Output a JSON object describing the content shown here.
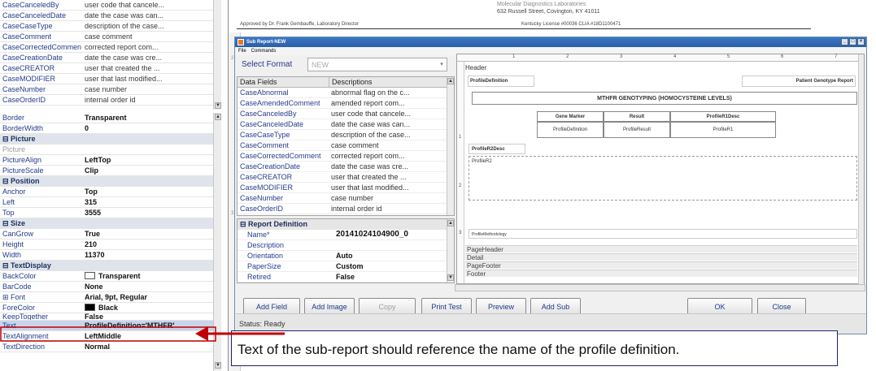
{
  "background_report": {
    "header": "Molecular Diagnostics Laboratories",
    "address": "632 Russell Street, Covington, KY 41011",
    "approved": "Approved by Dr. Frank Gembauffe, Laboratory Director",
    "license": "Kentucky License #00036 CLIA #18D1100471",
    "left_numbers": [
      "1",
      "2",
      "3"
    ]
  },
  "left_panel": {
    "fields_list": [
      [
        "CaseCanceledBy",
        "user code that cancele..."
      ],
      [
        "CaseCanceledDate",
        "date the case was can..."
      ],
      [
        "CaseCaseType",
        "description of the case..."
      ],
      [
        "CaseComment",
        "case comment"
      ],
      [
        "CaseCorrectedComment",
        "corrected report com..."
      ],
      [
        "CaseCreationDate",
        "date the case was cre..."
      ],
      [
        "CaseCREATOR",
        "user that created the ..."
      ],
      [
        "CaseMODIFIER",
        "user that last modified..."
      ],
      [
        "CaseNumber",
        "case number"
      ],
      [
        "CaseOrderID",
        "internal order id"
      ]
    ],
    "properties": {
      "border": [
        "Border",
        "Transparent"
      ],
      "border_width": [
        "BorderWidth",
        "0"
      ],
      "cat_picture": "Picture",
      "picture": [
        "Picture",
        ""
      ],
      "picture_align": [
        "PictureAlign",
        "LeftTop"
      ],
      "picture_scale": [
        "PictureScale",
        "Clip"
      ],
      "cat_position": "Position",
      "anchor": [
        "Anchor",
        "Top"
      ],
      "left": [
        "Left",
        "315"
      ],
      "top": [
        "Top",
        "3555"
      ],
      "cat_size": "Size",
      "can_grow": [
        "CanGrow",
        "True"
      ],
      "height": [
        "Height",
        "210"
      ],
      "width": [
        "Width",
        "11370"
      ],
      "cat_textdisplay": "TextDisplay",
      "back_color": [
        "BackColor",
        "Transparent"
      ],
      "bar_code": [
        "BarCode",
        "None"
      ],
      "font": [
        "Font",
        "Arial, 9pt, Regular"
      ],
      "fore_color": [
        "ForeColor",
        "Black"
      ],
      "keep_together": [
        "KeepTogether",
        "False"
      ],
      "text": [
        "Text",
        "ProfileDefinition='MTHFR'"
      ],
      "text_alignment": [
        "TextAlignment",
        "LeftMiddle"
      ],
      "text_direction": [
        "TextDirection",
        "Normal"
      ]
    },
    "colors": {
      "back": "#ffffff",
      "fore": "#000000"
    }
  },
  "window": {
    "title": "Sub Report-NEW",
    "menu": [
      "File",
      "Commands"
    ],
    "controls": [
      "_",
      "□",
      "×"
    ],
    "select_format_label": "Select Format",
    "select_format_value": "NEW",
    "fields_headers": [
      "Data Fields",
      "Descriptions"
    ],
    "fields": [
      [
        "CaseAbnormal",
        "abnormal flag on the c..."
      ],
      [
        "CaseAmendedComment",
        "amended report com..."
      ],
      [
        "CaseCanceledBy",
        "user code that cancele..."
      ],
      [
        "CaseCanceledDate",
        "date the case was can..."
      ],
      [
        "CaseCaseType",
        "description of the case..."
      ],
      [
        "CaseComment",
        "case comment"
      ],
      [
        "CaseCorrectedComment",
        "corrected report com..."
      ],
      [
        "CaseCreationDate",
        "date the case was cre..."
      ],
      [
        "CaseCREATOR",
        "user that created the ..."
      ],
      [
        "CaseMODIFIER",
        "user that last modified..."
      ],
      [
        "CaseNumber",
        "case number"
      ],
      [
        "CaseOrderID",
        "internal order id"
      ]
    ],
    "report_definition": {
      "title": "Report Definition",
      "rows": [
        [
          "Name*",
          "20141024104900_0"
        ],
        [
          "Description",
          ""
        ],
        [
          "Orientation",
          "Auto"
        ],
        [
          "PaperSize",
          "Custom"
        ],
        [
          "Retired",
          "False"
        ]
      ]
    },
    "design": {
      "ruler_marks": [
        "1",
        "2",
        "3",
        "4",
        "5",
        "6",
        "7"
      ],
      "vruler_marks": [
        "1",
        "2",
        "3"
      ],
      "header_label": "Header",
      "profile_definition": "ProfileDefinition",
      "patient_genotype": "Patient Genotype Report",
      "mthfr_title": "MTHFR GENOTYPING (HOMOCYSTEINE LEVELS)",
      "col_gene_marker": "Gene Marker",
      "col_result": "Result",
      "col_r1desc": "ProfileR1Desc",
      "val_profile_def": "ProfileDefinition",
      "val_profile_result": "ProfileResult",
      "val_profile_r1": "ProfileR1",
      "r2desc": "ProfileR2Desc",
      "r2": "ProfileR2",
      "methodology": "ProfileMethodology",
      "sections": [
        "PageHeader",
        "Detail",
        "PageFooter",
        "Footer"
      ]
    },
    "buttons": {
      "add_field": "Add Field",
      "add_image": "Add Image",
      "copy": "Copy",
      "print_test": "Print Test",
      "preview": "Preview",
      "add_sub": "Add Sub",
      "ok": "OK",
      "close": "Close"
    },
    "status": "Status: Ready"
  },
  "callout": {
    "text": "Text of the sub-report should reference the name of the profile definition.",
    "arrow_color": "#c00000"
  }
}
